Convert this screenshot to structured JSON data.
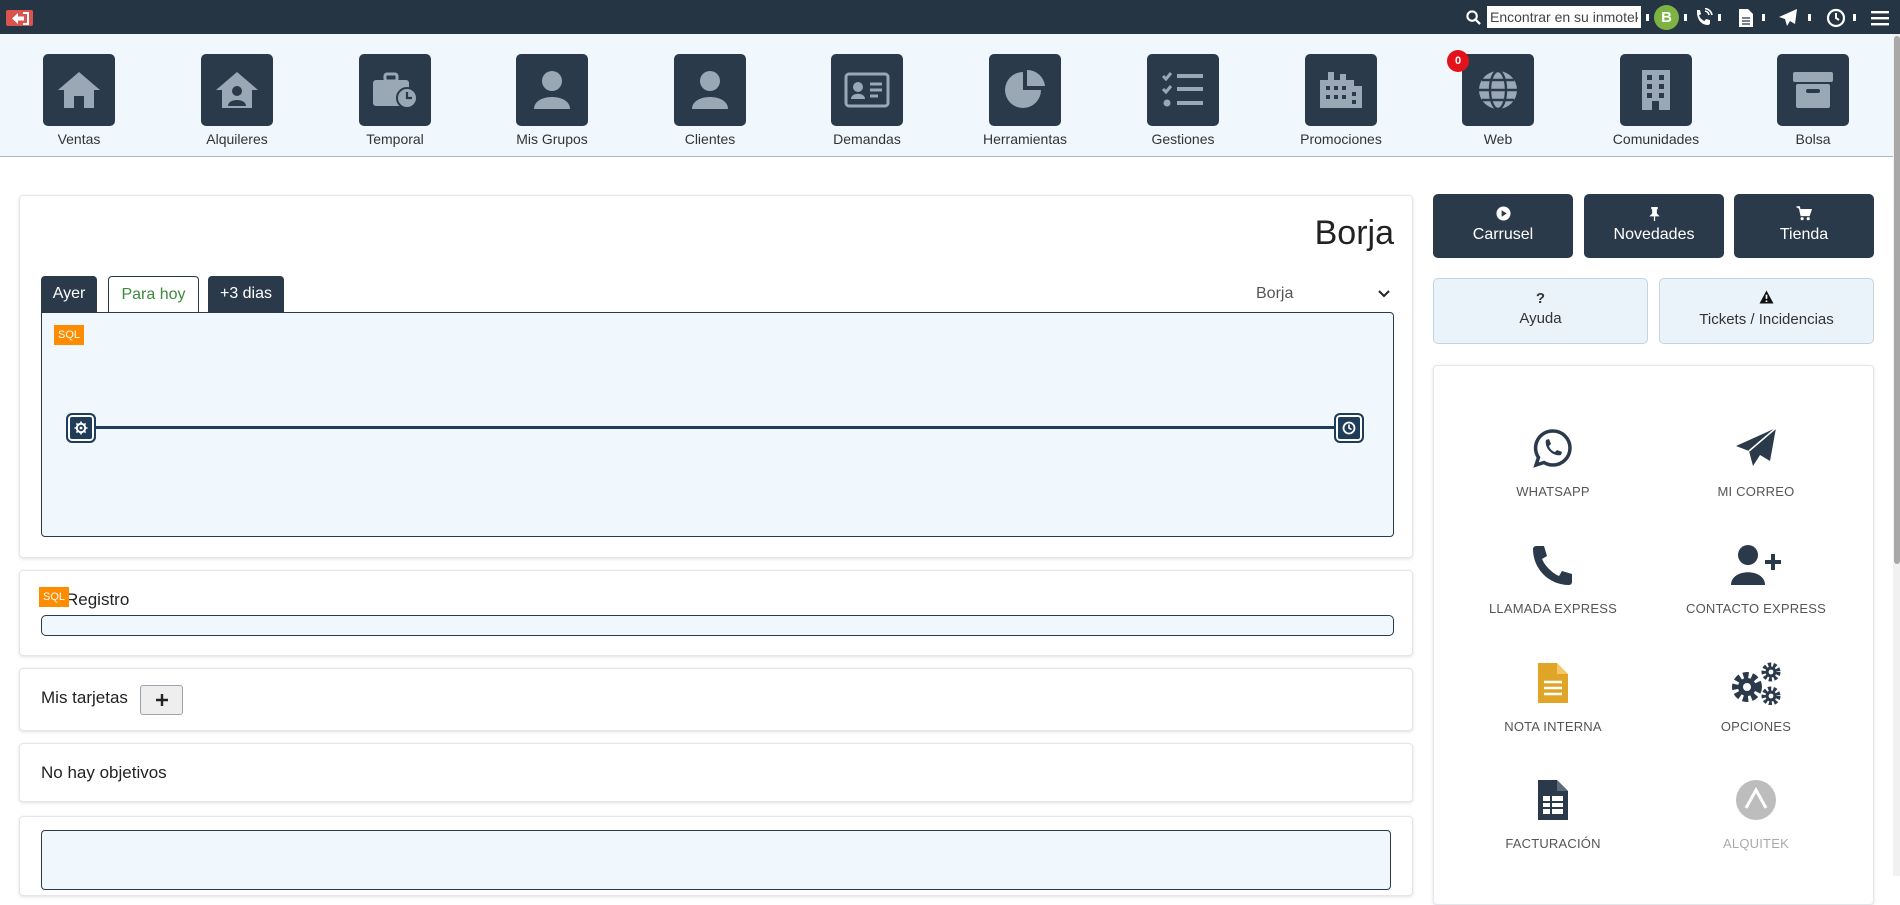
{
  "topbar": {
    "search_placeholder": "Encontrar en su inmotek",
    "avatar_initial": "B"
  },
  "nav": [
    {
      "label": "Ventas",
      "icon": "home-icon"
    },
    {
      "label": "Alquileres",
      "icon": "house-user-icon"
    },
    {
      "label": "Temporal",
      "icon": "briefcase-clock-icon"
    },
    {
      "label": "Mis Grupos",
      "icon": "user-icon"
    },
    {
      "label": "Clientes",
      "icon": "user-icon"
    },
    {
      "label": "Demandas",
      "icon": "id-card-icon"
    },
    {
      "label": "Herramientas",
      "icon": "pie-chart-icon"
    },
    {
      "label": "Gestiones",
      "icon": "checklist-icon"
    },
    {
      "label": "Promociones",
      "icon": "industry-icon"
    },
    {
      "label": "Web",
      "icon": "globe-icon",
      "badge": "0"
    },
    {
      "label": "Comunidades",
      "icon": "building-icon"
    },
    {
      "label": "Bolsa",
      "icon": "archive-icon"
    }
  ],
  "agenda": {
    "user_name": "Borja",
    "tabs": [
      "Ayer",
      "Para hoy",
      "+3 dias"
    ],
    "active_tab": "Para hoy",
    "selected_user": "Borja",
    "sql_tag": "SQL"
  },
  "registro": {
    "title": "Registro",
    "sql_tag": "SQL"
  },
  "tarjetas": {
    "title": "Mis tarjetas"
  },
  "objetivos": {
    "title": "No hay objetivos"
  },
  "right_buttons": [
    {
      "label": "Carrusel",
      "icon": "play-circle-icon"
    },
    {
      "label": "Novedades",
      "icon": "thumbtack-icon"
    },
    {
      "label": "Tienda",
      "icon": "cart-icon"
    }
  ],
  "help_buttons": [
    {
      "label": "Ayuda",
      "icon": "question-icon"
    },
    {
      "label": "Tickets / Incidencias",
      "icon": "warning-icon"
    }
  ],
  "quick_actions": [
    {
      "label": "WHATSAPP",
      "icon": "whatsapp-icon"
    },
    {
      "label": "MI CORREO",
      "icon": "paper-plane-icon"
    },
    {
      "label": "LLAMADA EXPRESS",
      "icon": "phone-icon"
    },
    {
      "label": "CONTACTO EXPRESS",
      "icon": "user-plus-icon"
    },
    {
      "label": "NOTA INTERNA",
      "icon": "file-text-icon"
    },
    {
      "label": "OPCIONES",
      "icon": "gears-icon"
    },
    {
      "label": "FACTURACIÓN",
      "icon": "invoice-icon"
    },
    {
      "label": "ALQUITEK",
      "icon": "alquitek-logo-icon"
    }
  ],
  "colors": {
    "dark": "#2b3a4a",
    "accent_green": "#3c8a3c",
    "sql_orange": "#ff8c00",
    "note_yellow": "#e0a526"
  }
}
